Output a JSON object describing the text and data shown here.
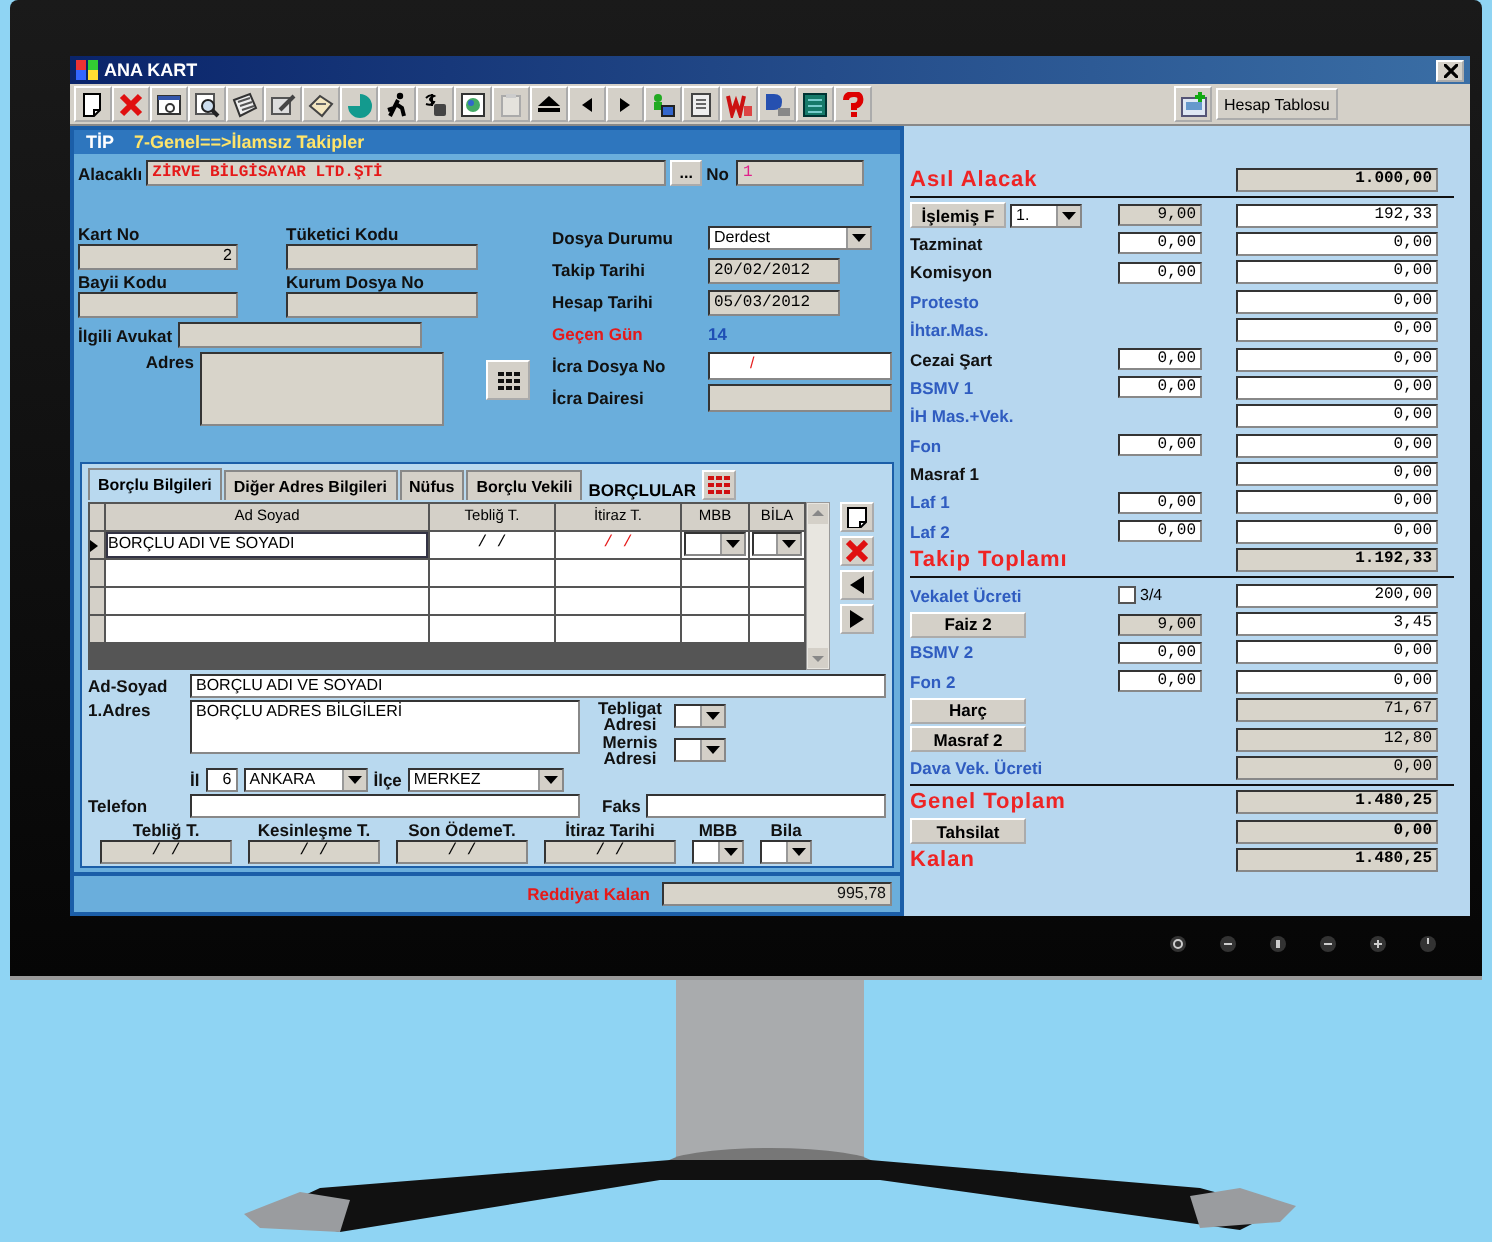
{
  "window": {
    "title": "ANA KART"
  },
  "toolbar": {
    "report_button": "Hesap Tablosu"
  },
  "tip": {
    "label": "TİP",
    "value": "7-Genel==>İlamsız Takipler"
  },
  "creditor": {
    "label": "Alacaklı",
    "value": "ZİRVE BİLGİSAYAR LTD.ŞTİ",
    "browse": "...",
    "no_label": "No",
    "no": "1"
  },
  "codes": [
    {
      "label": "Kart No",
      "value": "2"
    },
    {
      "label": "Tüketici Kodu"
    },
    {
      "label": "Bayii Kodu"
    },
    {
      "label": "Kurum Dosya No"
    }
  ],
  "lawyer": {
    "label": "İlgili Avukat"
  },
  "address": {
    "label": "Adres"
  },
  "file_info": [
    {
      "kind": "dropdown",
      "label": "Dosya Durumu",
      "value": "Derdest"
    },
    {
      "kind": "date",
      "label": "Takip Tarihi",
      "value": "20/02/2012"
    },
    {
      "kind": "date",
      "label": "Hesap Tarihi",
      "value": "05/03/2012"
    },
    {
      "kind": "counter",
      "label": "Geçen Gün",
      "value": "14"
    },
    {
      "kind": "entry",
      "label": "İcra Dosya No",
      "value": "/"
    },
    {
      "kind": "readonly",
      "label": "İcra Dairesi"
    }
  ],
  "tabs": [
    {
      "label": "Borçlu Bilgileri",
      "selected": true
    },
    {
      "label": "Diğer Adres Bilgileri",
      "selected": false
    },
    {
      "label": "Nüfus",
      "selected": false
    },
    {
      "label": "Borçlu Vekili",
      "selected": false
    }
  ],
  "debtors_label": "BORÇLULAR",
  "debtor_table": {
    "columns": [
      "Ad Soyad",
      "Tebliğ T.",
      "İtiraz T.",
      "MBB",
      "BİLA"
    ],
    "rows": [
      {
        "selected": true,
        "cells": [
          "BORÇLU ADI VE SOYADI",
          "/  /",
          "/  /"
        ]
      },
      {
        "selected": false
      },
      {
        "selected": false
      },
      {
        "selected": false
      }
    ]
  },
  "debtor": {
    "name_label": "Ad-Soyad",
    "name": "BORÇLU ADI VE SOYADI",
    "address_label": "1.Adres",
    "address": "BORÇLU ADRES BİLGİLERİ",
    "notice_label": "Tebligat Adresi",
    "mernis_label": "Mernis Adresi",
    "city_label": "İl",
    "city_code": "6",
    "city": "ANKARA",
    "district_label": "İlçe",
    "district": "MERKEZ",
    "phone_label": "Telefon",
    "fax_label": "Faks"
  },
  "debtor_dates": [
    {
      "kind": "date",
      "label": "Tebliğ T.",
      "value": "/  /"
    },
    {
      "kind": "date",
      "label": "Kesinleşme T.",
      "value": "/  /"
    },
    {
      "kind": "date",
      "label": "Son ÖdemeT.",
      "value": "/  /"
    },
    {
      "kind": "date",
      "label": "İtiraz Tarihi",
      "value": "/  /"
    },
    {
      "kind": "dropdown",
      "label": "MBB"
    },
    {
      "kind": "dropdown",
      "label": "Bila"
    }
  ],
  "refund": {
    "label": "Reddiyat Kalan",
    "value": "995,78"
  },
  "accounts": [
    {
      "kind": "heading",
      "label": "Asıl Alacak",
      "value": "1.000,00",
      "readonly": true,
      "divider_after": true
    },
    {
      "kind": "button",
      "label": "İşlemiş F",
      "option": "1.",
      "mid": {
        "value": "9,00",
        "readonly": true
      },
      "value": "192,33",
      "readonly": false
    },
    {
      "kind": "plain",
      "label": "Tazminat",
      "mid": {
        "value": "0,00",
        "readonly": false
      },
      "value": "0,00",
      "readonly": false
    },
    {
      "kind": "plain",
      "label": "Komisyon",
      "mid": {
        "value": "0,00",
        "readonly": false
      },
      "value": "0,00",
      "readonly": false
    },
    {
      "kind": "accent",
      "label": "Protesto",
      "value": "0,00",
      "readonly": false
    },
    {
      "kind": "accent",
      "label": "İhtar.Mas.",
      "value": "0,00",
      "readonly": false
    },
    {
      "kind": "plain",
      "label": "Cezai Şart",
      "mid": {
        "value": "0,00",
        "readonly": false
      },
      "value": "0,00",
      "readonly": false
    },
    {
      "kind": "accent",
      "label": "BSMV 1",
      "mid": {
        "value": "0,00",
        "readonly": false
      },
      "value": "0,00",
      "readonly": false
    },
    {
      "kind": "accent",
      "label": "İH Mas.+Vek.",
      "value": "0,00",
      "readonly": false
    },
    {
      "kind": "accent",
      "label": "Fon",
      "mid": {
        "value": "0,00",
        "readonly": false
      },
      "value": "0,00",
      "readonly": false
    },
    {
      "kind": "plain",
      "label": "Masraf 1",
      "value": "0,00",
      "readonly": false
    },
    {
      "kind": "accent",
      "label": "Laf 1",
      "mid": {
        "value": "0,00",
        "readonly": false
      },
      "value": "0,00",
      "readonly": false
    },
    {
      "kind": "accent",
      "label": "Laf 2",
      "mid": {
        "value": "0,00",
        "readonly": false
      },
      "value": "0,00",
      "readonly": false
    },
    {
      "kind": "heading",
      "label": "Takip Toplamı",
      "value": "1.192,33",
      "readonly": true,
      "divider_after": true
    },
    {
      "kind": "accent",
      "label": "Vekalet Ücreti",
      "check": {
        "label": "3/4",
        "checked": false
      },
      "value": "200,00",
      "readonly": false
    },
    {
      "kind": "button",
      "label": "Faiz 2",
      "mid": {
        "value": "9,00",
        "readonly": true
      },
      "value": "3,45",
      "readonly": false
    },
    {
      "kind": "accent",
      "label": "BSMV 2",
      "mid": {
        "value": "0,00",
        "readonly": false
      },
      "value": "0,00",
      "readonly": false
    },
    {
      "kind": "accent",
      "label": "Fon 2",
      "mid": {
        "value": "0,00",
        "readonly": false
      },
      "value": "0,00",
      "readonly": false
    },
    {
      "kind": "button",
      "label": "Harç",
      "value": "71,67",
      "readonly": true
    },
    {
      "kind": "button",
      "label": "Masraf 2",
      "value": "12,80",
      "readonly": true
    },
    {
      "kind": "accent",
      "label": "Dava Vek. Ücreti",
      "value": "0,00",
      "readonly": true,
      "divider_after": true
    },
    {
      "kind": "heading",
      "label": "Genel Toplam",
      "value": "1.480,25",
      "readonly": true
    },
    {
      "kind": "button",
      "label": "Tahsilat",
      "value": "0,00",
      "readonly": true,
      "emphasis": true
    },
    {
      "kind": "heading",
      "label": "Kalan",
      "value": "1.480,25",
      "readonly": true
    }
  ]
}
